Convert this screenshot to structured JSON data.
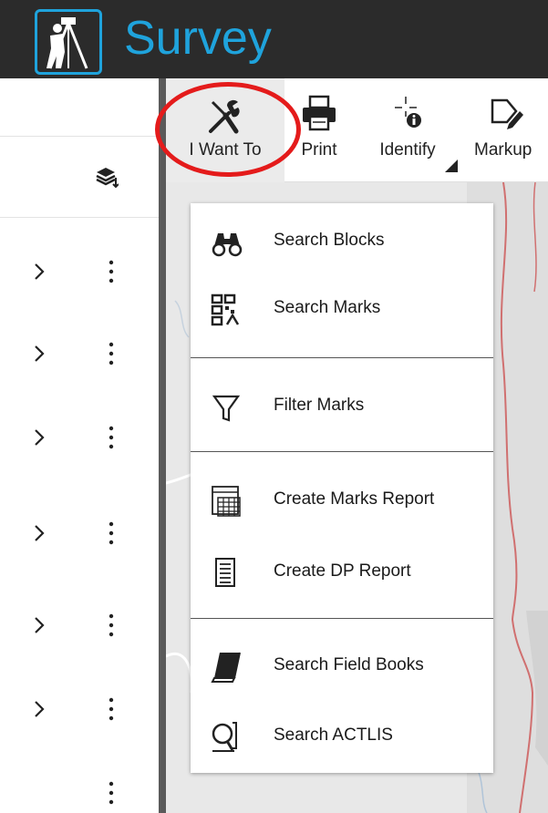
{
  "app": {
    "title": "Survey",
    "accent_color": "#1fa3dc",
    "header_bg": "#2b2b2b"
  },
  "left_panel": {
    "layers_icon": "layers-sort-icon",
    "rows": [
      {
        "expand_icon": "chevron-right-icon",
        "menu_icon": "kebab-menu-icon"
      },
      {
        "expand_icon": "chevron-right-icon",
        "menu_icon": "kebab-menu-icon"
      },
      {
        "expand_icon": "chevron-right-icon",
        "menu_icon": "kebab-menu-icon"
      },
      {
        "expand_icon": "chevron-right-icon",
        "menu_icon": "kebab-menu-icon"
      },
      {
        "expand_icon": "chevron-right-icon",
        "menu_icon": "kebab-menu-icon"
      },
      {
        "expand_icon": "chevron-right-icon",
        "menu_icon": "kebab-menu-icon"
      }
    ]
  },
  "toolbar": {
    "i_want_to": "I Want To",
    "print": "Print",
    "identify": "Identify",
    "markup": "Markup"
  },
  "menu": {
    "search_blocks": "Search Blocks",
    "search_marks": "Search Marks",
    "filter_marks": "Filter Marks",
    "create_marks_report": "Create Marks Report",
    "create_dp_report": "Create DP Report",
    "search_field_books": "Search Field Books",
    "search_actlis": "Search ACTLIS"
  },
  "highlight_color": "#e41b1b"
}
